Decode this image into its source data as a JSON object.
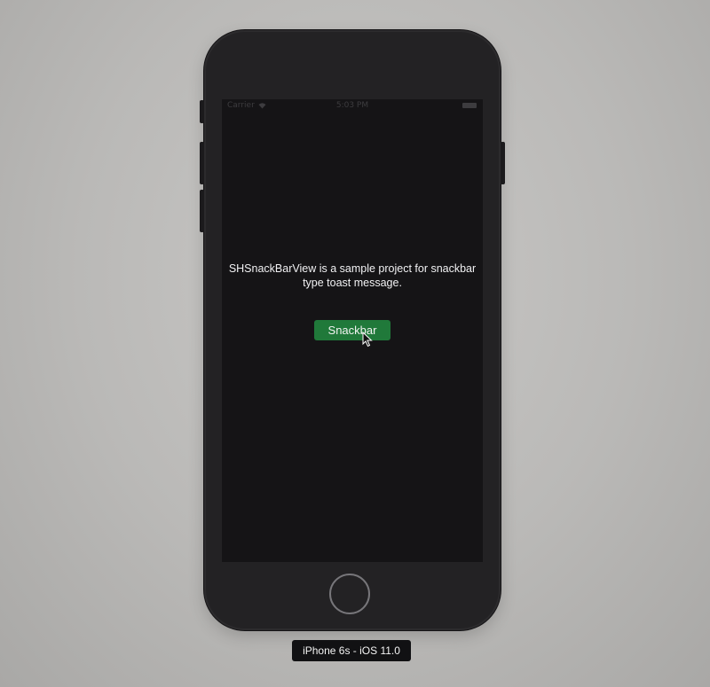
{
  "status_bar": {
    "carrier": "Carrier",
    "time": "5:03 PM",
    "wifi_icon": "wifi-icon",
    "battery_icon": "battery-icon"
  },
  "app": {
    "description": "SHSnackBarView is a sample project for snackbar\ntype toast message.",
    "snackbar_button_label": "Snackbar"
  },
  "simulator": {
    "device_label": "iPhone 6s - iOS 11.0"
  },
  "colors": {
    "screen_background": "#151416",
    "button_background": "#20793a",
    "text": "#f1f1f3",
    "device_body": "#232224"
  }
}
